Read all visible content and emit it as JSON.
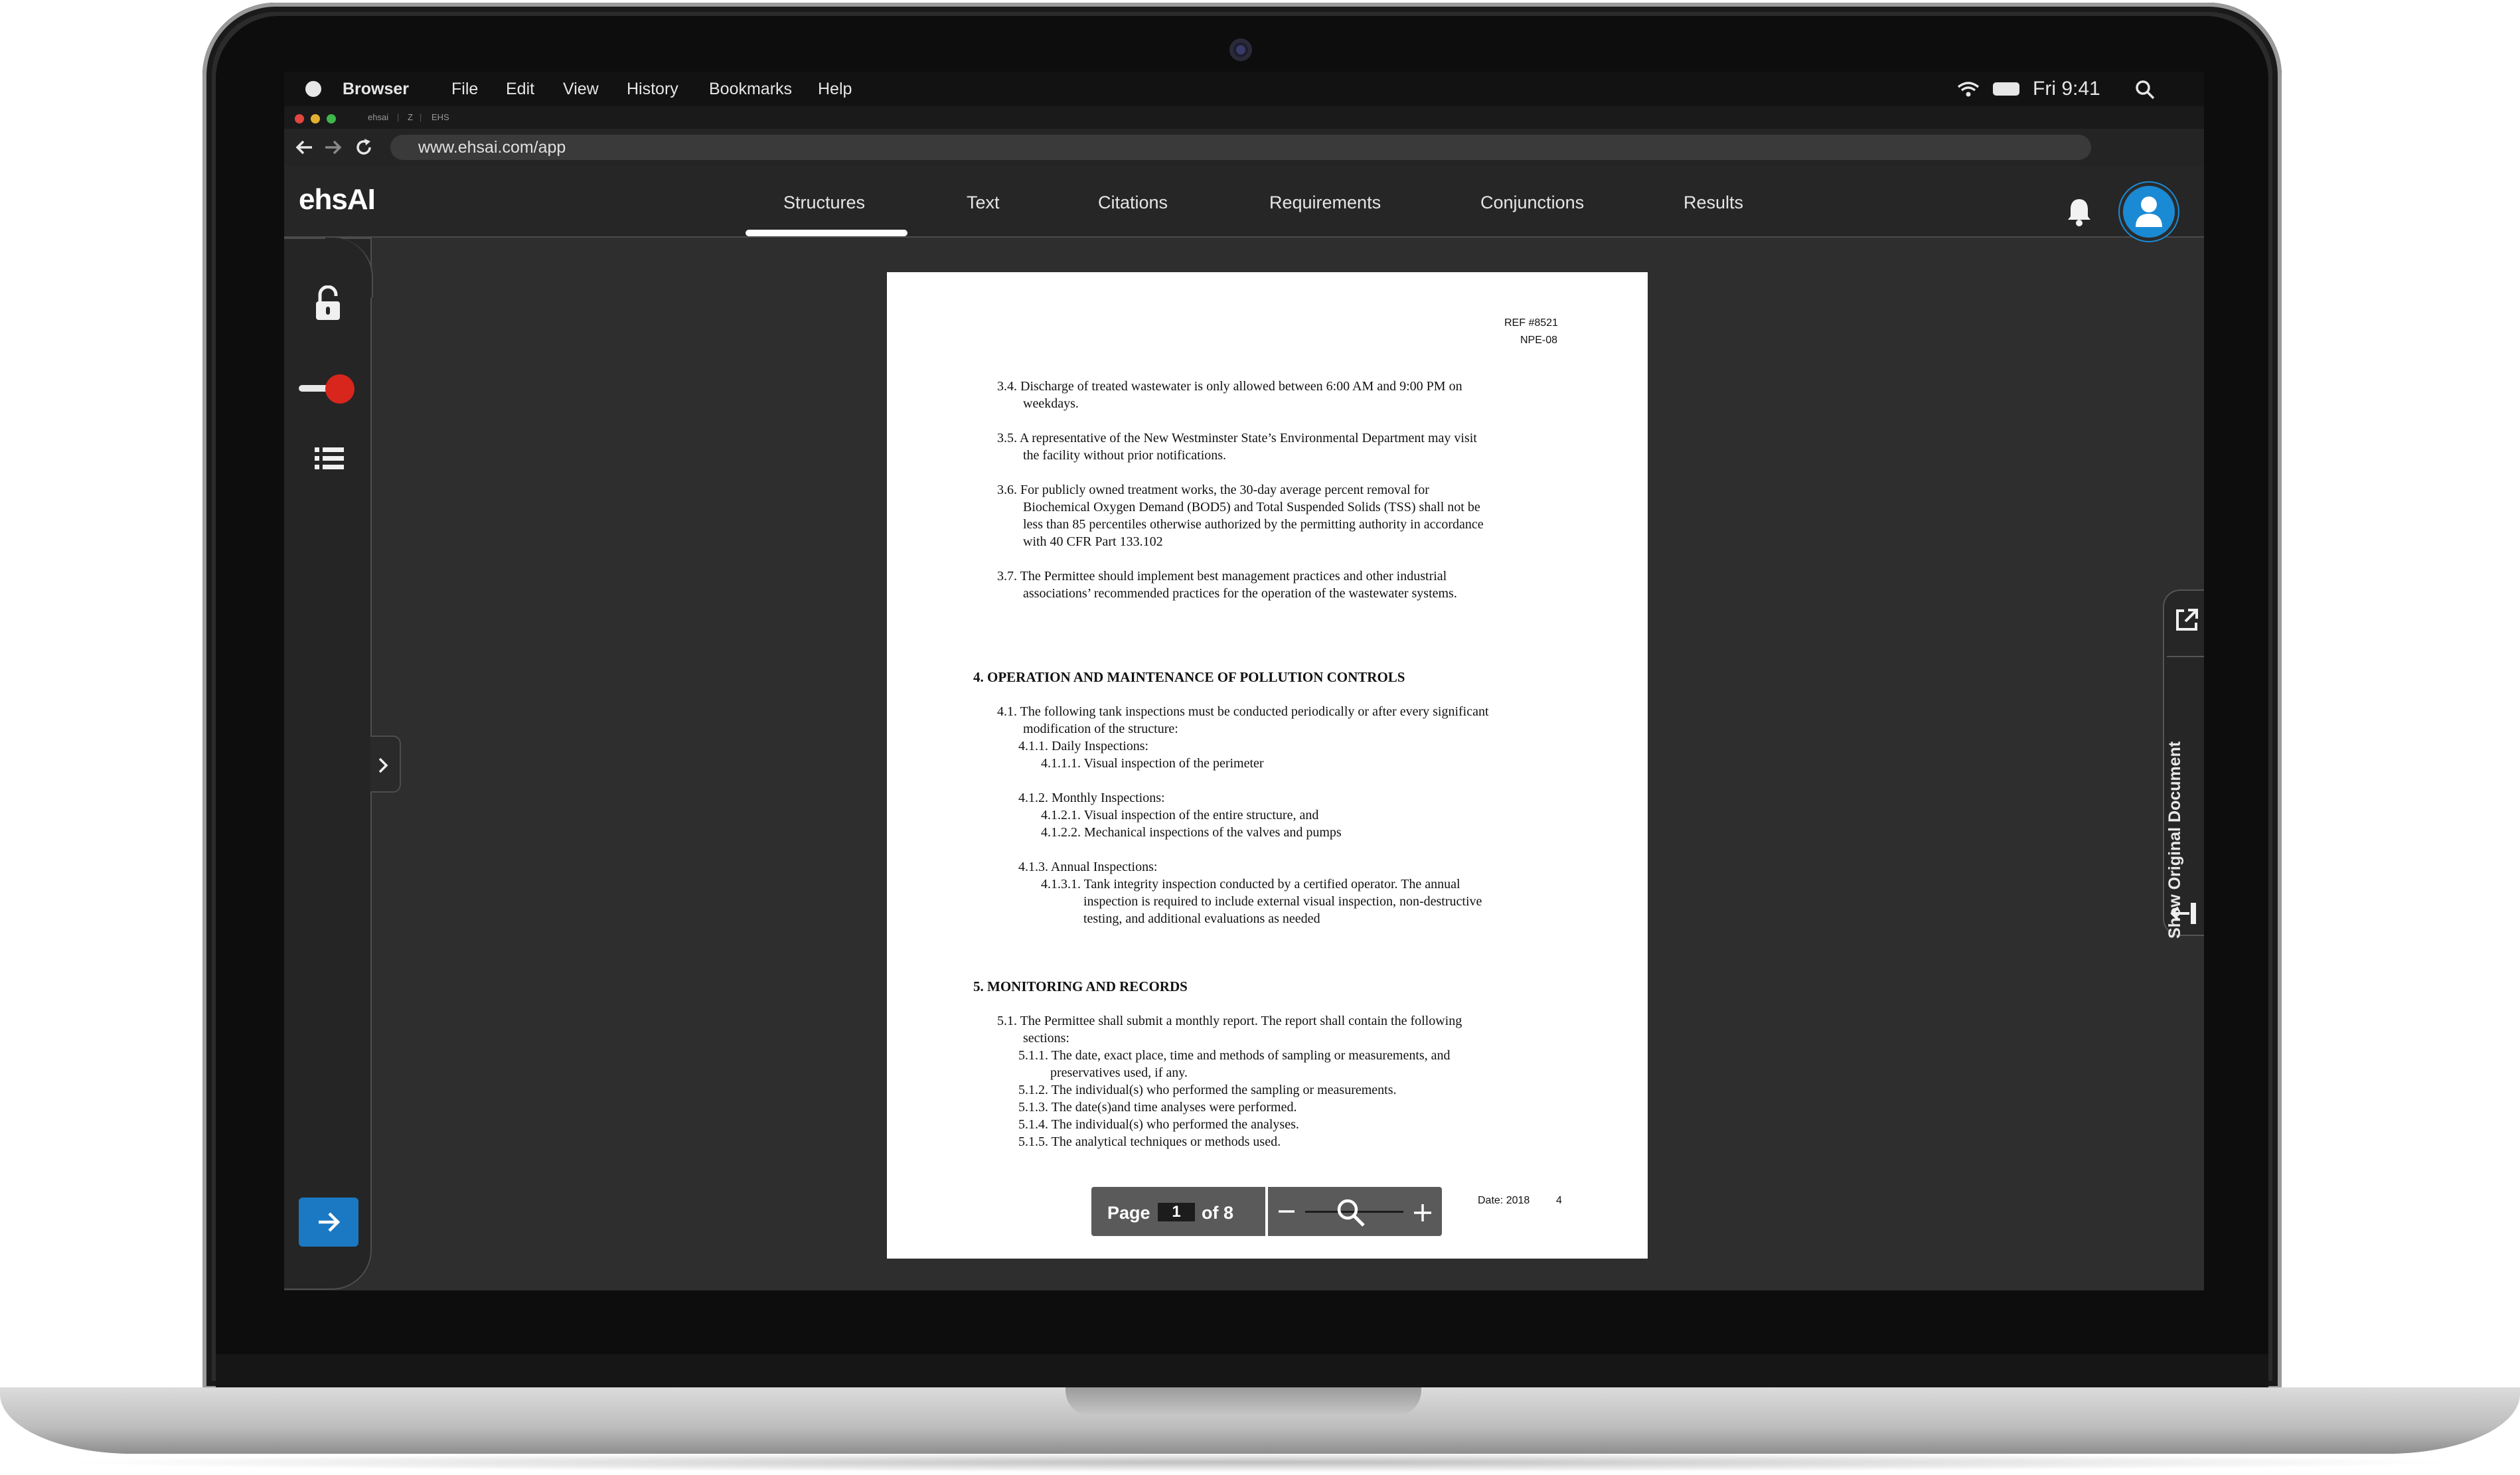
{
  "menubar": {
    "app_name": "Browser",
    "items": [
      "File",
      "Edit",
      "View",
      "History",
      "Bookmarks",
      "Help"
    ],
    "clock": "Fri  9:41"
  },
  "browser": {
    "tabs": [
      "ehsai",
      "Z",
      "EHS"
    ],
    "url": "www.ehsai.com/app"
  },
  "app": {
    "logo": "ehsAI",
    "tabs": [
      "Structures",
      "Text",
      "Citations",
      "Requirements",
      "Conjunctions",
      "Results"
    ],
    "active_tab": "Structures"
  },
  "document": {
    "ref_line1": "REF #8521",
    "ref_line2": "NPE-08",
    "lines": [
      "3.4.  Discharge of treated wastewater is only allowed between 6:00 AM and 9:00 PM on",
      "weekdays.",
      "3.5.  A representative of the New Westminster State’s Environmental Department may visit",
      "the facility without prior notifications.",
      "3.6.  For publicly owned treatment works, the 30-day average percent removal for",
      "Biochemical Oxygen Demand (BOD5) and Total Suspended Solids (TSS) shall not be",
      "less than 85 percentiles otherwise authorized by the permitting authority in accordance",
      "with 40 CFR Part 133.102",
      "3.7.  The Permittee should implement best management practices and other industrial",
      "associations’ recommended practices for the operation of the wastewater systems.",
      "4.1.  The following tank inspections must be conducted periodically or after every significant",
      "modification of the structure:",
      "4.1.1.   Daily Inspections:",
      "4.1.1.1.      Visual inspection of the perimeter",
      "4.1.2.   Monthly Inspections:",
      "4.1.2.1.      Visual inspection of the entire structure, and",
      "4.1.2.2.      Mechanical inspections of the valves and pumps",
      "4.1.3.   Annual Inspections:",
      "4.1.3.1.      Tank integrity inspection conducted by a certified operator. The annual",
      "inspection is required to include external visual inspection, non-destructive",
      "testing, and additional evaluations as needed",
      "5.1.  The Permittee shall submit a monthly report. The report shall contain the following",
      "sections:",
      "5.1.1.   The date, exact place, time and methods of sampling or measurements, and",
      "preservatives used, if any.",
      "5.1.2.   The individual(s) who performed the sampling or measurements.",
      "5.1.3.   The date(s)and time analyses were performed.",
      "5.1.4.   The individual(s) who performed the analyses.",
      "5.1.5.   The analytical techniques or methods used."
    ],
    "headings": [
      "4.   OPERATION AND MAINTENANCE OF POLLUTION CONTROLS",
      "5.   MONITORING AND RECORDS"
    ],
    "footer_date": "Date: 2018",
    "footer_page": "4"
  },
  "pager": {
    "label": "Page",
    "current": "1",
    "of_total": "of 8"
  },
  "side_panel": {
    "show_original": "Show Original Document"
  },
  "colors": {
    "accent": "#1b78c2",
    "toggle": "#d8261c",
    "background": "#2e2e2e"
  },
  "icons": [
    "lock-open-icon",
    "toggle-icon",
    "list-icon",
    "arrow-right-icon",
    "bell-icon",
    "user-icon",
    "search-icon",
    "wifi-icon",
    "battery-icon",
    "external-link-icon",
    "zoom-icon"
  ]
}
